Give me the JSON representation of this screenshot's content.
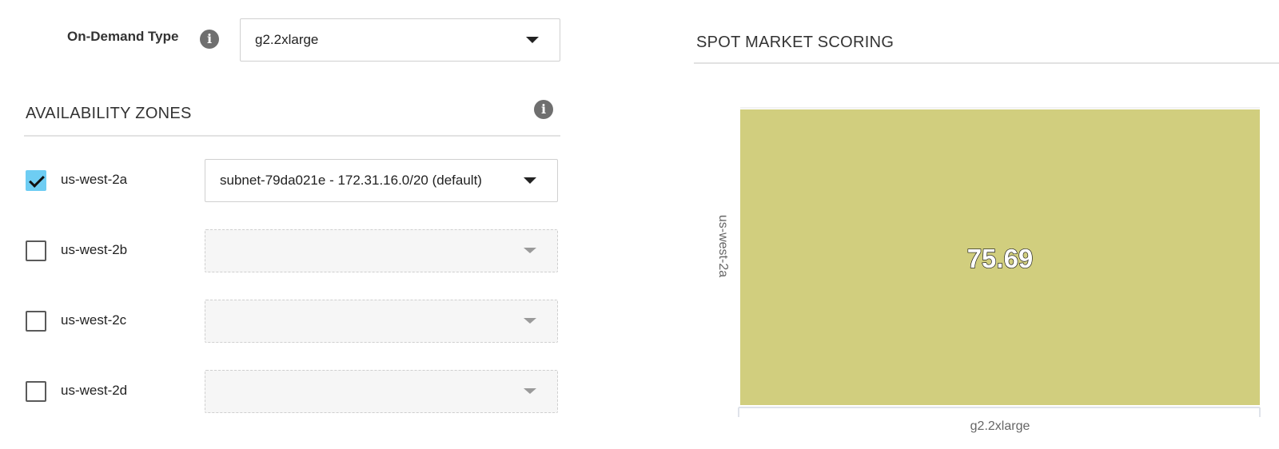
{
  "on_demand": {
    "label": "On-Demand Type",
    "selected_value": "g2.2xlarge",
    "info_icon": "info-icon"
  },
  "availability_zones": {
    "title": "AVAILABILITY ZONES",
    "info_icon": "info-icon",
    "zones": [
      {
        "name": "us-west-2a",
        "checked": true,
        "subnet": "subnet-79da021e - 172.31.16.0/20 (default)",
        "enabled": true
      },
      {
        "name": "us-west-2b",
        "checked": false,
        "subnet": "",
        "enabled": false
      },
      {
        "name": "us-west-2c",
        "checked": false,
        "subnet": "",
        "enabled": false
      },
      {
        "name": "us-west-2d",
        "checked": false,
        "subnet": "",
        "enabled": false
      }
    ]
  },
  "spot_market": {
    "title": "SPOT MARKET SCORING"
  },
  "chart_data": {
    "type": "heatmap",
    "title": "",
    "x_categories": [
      "g2.2xlarge"
    ],
    "y_categories": [
      "us-west-2a"
    ],
    "values": [
      [
        75.69
      ]
    ],
    "cell_labels": [
      "75.69"
    ],
    "cell_color": "#d1ce7e",
    "label_color": "#ffffff",
    "label_outline_color": "#111111"
  },
  "colors": {
    "checkbox_checked": "#6ecdf3",
    "info_icon": "#6f6f6f",
    "divider": "#e2e2e2"
  }
}
